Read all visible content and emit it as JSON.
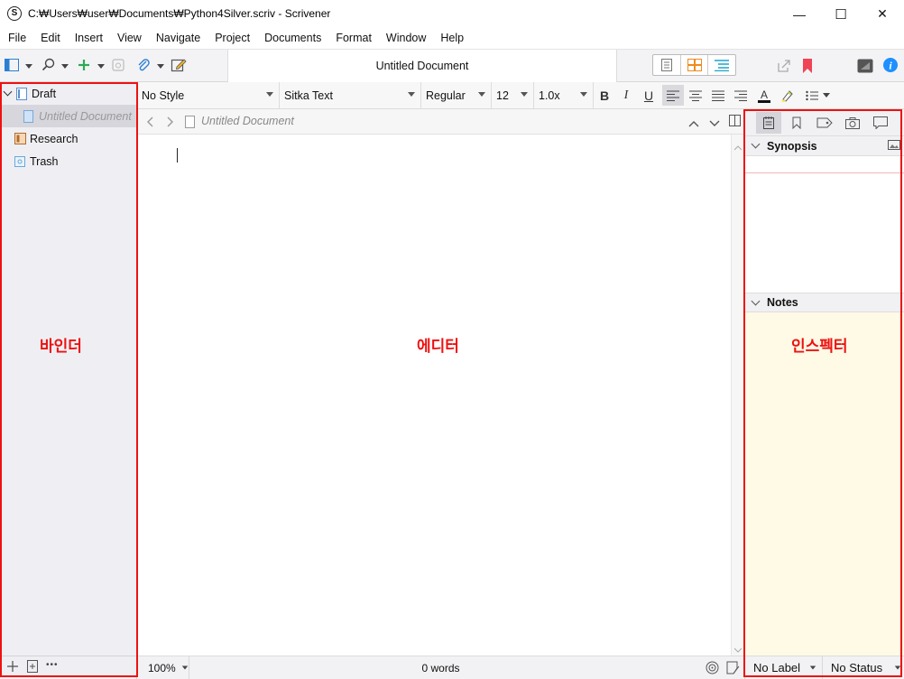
{
  "window": {
    "title": "C:₩Users₩user₩Documents₩Python4Silver.scriv - Scrivener",
    "app_icon_letter": "S",
    "minimize_glyph": "—",
    "maximize_glyph": "☐",
    "close_glyph": "✕"
  },
  "menu": [
    "File",
    "Edit",
    "Insert",
    "View",
    "Navigate",
    "Project",
    "Documents",
    "Format",
    "Window",
    "Help"
  ],
  "toolbar": {
    "document_title": "Untitled Document"
  },
  "format_bar": {
    "style": "No Style",
    "font": "Sitka Text",
    "weight": "Regular",
    "size": "12",
    "line_spacing": "1.0x",
    "bold": "B",
    "italic": "I",
    "underline": "U"
  },
  "binder": {
    "items": [
      {
        "label": "Draft"
      },
      {
        "label": "Untitled Document"
      },
      {
        "label": "Research"
      },
      {
        "label": "Trash"
      }
    ],
    "footer_more": "•••"
  },
  "editor": {
    "header_title": "Untitled Document",
    "zoom": "100%",
    "word_count": "0 words"
  },
  "inspector": {
    "synopsis_label": "Synopsis",
    "notes_label": "Notes",
    "label_select": "No Label",
    "status_select": "No Status"
  },
  "annotations": {
    "binder": "바인더",
    "editor": "에디터",
    "inspector": "인스펙터",
    "color": "#ee1111"
  },
  "colors": {
    "accent_blue": "#1e90ff",
    "add_green": "#2eaa55",
    "bookmark_red": "#ee4455",
    "notes_bg": "#fffae6"
  }
}
